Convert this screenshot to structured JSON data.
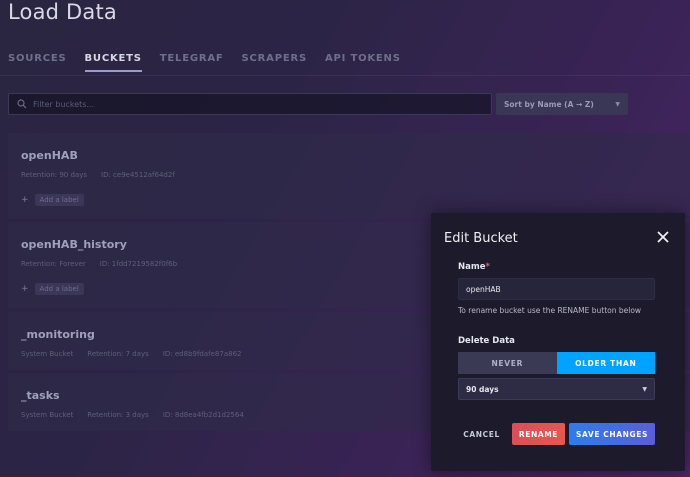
{
  "page": {
    "title": "Load Data",
    "tabs": [
      "SOURCES",
      "BUCKETS",
      "TELEGRAF",
      "SCRAPERS",
      "API TOKENS"
    ],
    "active_tab": "BUCKETS"
  },
  "filter": {
    "placeholder": "Filter buckets..."
  },
  "sort": {
    "value": "Sort by Name (A → Z)"
  },
  "buckets": [
    {
      "name": "openHAB",
      "retention": "Retention: 90 days",
      "id": "ID: ce9e4512af64d2f",
      "add_label": "Add a label"
    },
    {
      "name": "openHAB_history",
      "retention": "Retention: Forever",
      "id": "ID: 1fdd7219582f0f6b",
      "add_label": "Add a label"
    },
    {
      "name": "_monitoring",
      "type": "System Bucket",
      "retention": "Retention: 7 days",
      "id": "ID: ed8b9fdafe87a862"
    },
    {
      "name": "_tasks",
      "type": "System Bucket",
      "retention": "Retention: 3 days",
      "id": "ID: 8d8ea4fb2d1d2564"
    }
  ],
  "modal": {
    "title": "Edit Bucket",
    "name_label": "Name",
    "required_mark": "*",
    "name_value": "openHAB",
    "hint": "To rename bucket use the RENAME button below",
    "delete_label": "Delete Data",
    "toggle_never": "NEVER",
    "toggle_older": "OLDER THAN",
    "duration": "90 days",
    "cancel": "CANCEL",
    "rename": "RENAME",
    "save": "SAVE CHANGES"
  },
  "colors": {
    "accent": "#00a3ff",
    "rename": "#dc4e58",
    "save": "#2c7cf0"
  }
}
